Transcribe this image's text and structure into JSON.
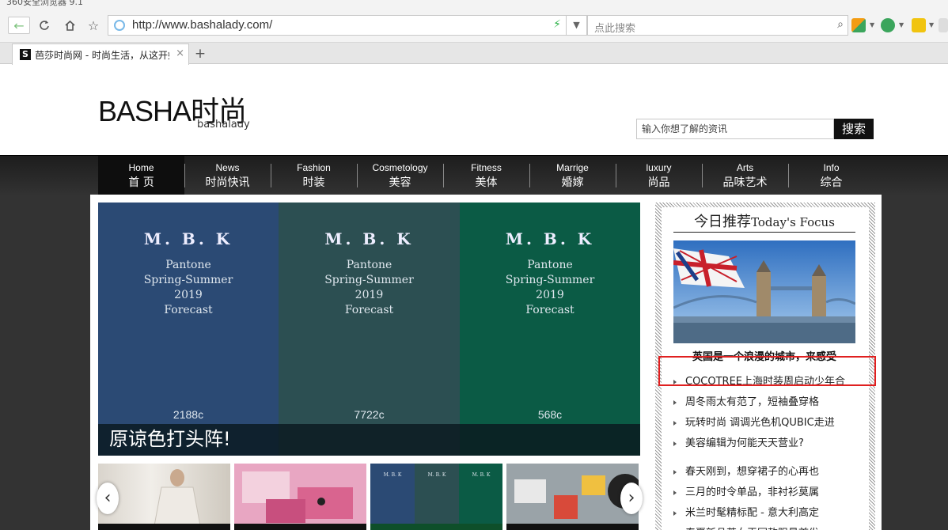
{
  "browser": {
    "title": "360安全浏览器 9.1",
    "url": "http://www.bashalady.com/",
    "search_placeholder": "点此搜索",
    "tab_title": "芭莎时尚网 - 时尚生活，从这开始",
    "tab_favicon": "S",
    "new_tab": "+",
    "close": "×"
  },
  "site": {
    "logo_main": "BASHA时尚",
    "logo_sub": "bashalady",
    "search_placeholder": "输入你想了解的资讯",
    "search_button": "搜索"
  },
  "nav": [
    {
      "en": "Home",
      "zh": "首 页"
    },
    {
      "en": "News",
      "zh": "时尚快讯"
    },
    {
      "en": "Fashion",
      "zh": "时装"
    },
    {
      "en": "Cosmetology",
      "zh": "美容"
    },
    {
      "en": "Fitness",
      "zh": "美体"
    },
    {
      "en": "Marrige",
      "zh": "婚嫁"
    },
    {
      "en": "luxury",
      "zh": "尚品"
    },
    {
      "en": "Arts",
      "zh": "品味艺术"
    },
    {
      "en": "Info",
      "zh": "综合"
    }
  ],
  "hero": {
    "swatches": [
      {
        "brand": "M. B. K",
        "l1": "Pantone",
        "l2": "Spring-Summer",
        "l3": "2019",
        "l4": "Forecast",
        "code": "2188c",
        "color": "#2b4a74"
      },
      {
        "brand": "M. B. K",
        "l1": "Pantone",
        "l2": "Spring-Summer",
        "l3": "2019",
        "l4": "Forecast",
        "code": "7722c",
        "color": "#2c4f52"
      },
      {
        "brand": "M. B. K",
        "l1": "Pantone",
        "l2": "Spring-Summer",
        "l3": "2019",
        "l4": "Forecast",
        "code": "568c",
        "color": "#0b5b45"
      }
    ],
    "caption": "原谅色打头阵!"
  },
  "sidebar": {
    "title_zh": "今日推荐",
    "title_en": "Today's Focus",
    "focus_caption": "英国是一个浪漫的城市，来感受",
    "items": [
      "COCOTREE上海时装周启动少年合",
      "周冬雨太有范了，短袖叠穿格",
      "玩转时尚 调调光色机QUBIC走进",
      "美容编辑为何能天天营业?",
      "春天刚到，想穿裙子的心再也",
      "三月的时令单品，非衬衫莫属",
      "米兰时髦精标配 - 意大利高定",
      "春夏新品英女王同款限量首发"
    ]
  },
  "colors": {
    "highlight": "#e02020",
    "nav_bg": "#262626"
  }
}
